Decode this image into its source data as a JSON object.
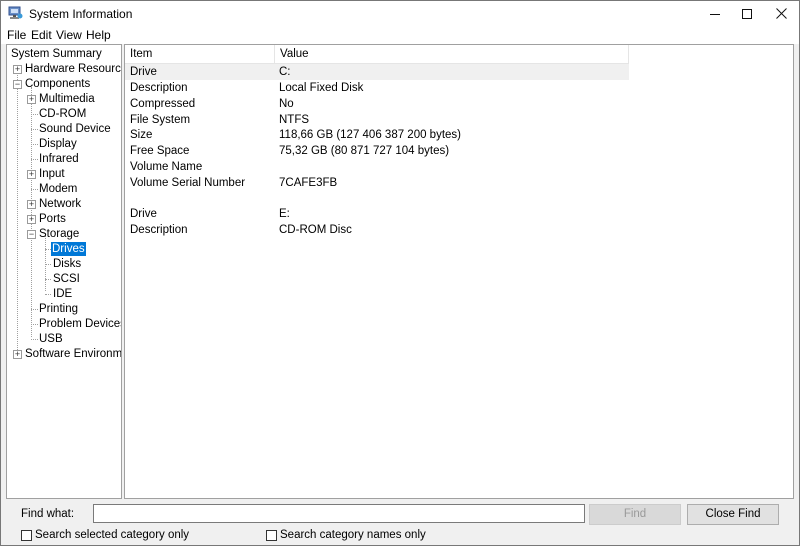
{
  "window": {
    "title": "System Information",
    "controls": {
      "minimize": "—",
      "maximize": "□",
      "close": "✕"
    }
  },
  "menu": [
    "File",
    "Edit",
    "View",
    "Help"
  ],
  "tree": {
    "root": "System Summary",
    "hardware": "Hardware Resources",
    "components": "Components",
    "component_items": [
      "Multimedia",
      "CD-ROM",
      "Sound Device",
      "Display",
      "Infrared",
      "Input",
      "Modem",
      "Network",
      "Ports",
      "Storage"
    ],
    "storage_items": [
      "Drives",
      "Disks",
      "SCSI",
      "IDE"
    ],
    "more_components": [
      "Printing",
      "Problem Devices",
      "USB"
    ],
    "software": "Software Environment",
    "selected": "Drives"
  },
  "detail": {
    "columns": [
      "Item",
      "Value"
    ],
    "rows": [
      {
        "item": "Drive",
        "value": "C:"
      },
      {
        "item": "Description",
        "value": "Local Fixed Disk"
      },
      {
        "item": "Compressed",
        "value": "No"
      },
      {
        "item": "File System",
        "value": "NTFS"
      },
      {
        "item": "Size",
        "value": "118,66 GB (127 406 387 200 bytes)"
      },
      {
        "item": "Free Space",
        "value": "75,32 GB (80 871 727 104 bytes)"
      },
      {
        "item": "Volume Name",
        "value": ""
      },
      {
        "item": "Volume Serial Number",
        "value": "7CAFE3FB"
      },
      {
        "item": "",
        "value": ""
      },
      {
        "item": "Drive",
        "value": "E:"
      },
      {
        "item": "Description",
        "value": "CD-ROM Disc"
      }
    ]
  },
  "find": {
    "label": "Find what:",
    "value": "",
    "find_button": "Find",
    "close_button": "Close Find",
    "search_selected": "Search selected category only",
    "search_names": "Search category names only"
  }
}
